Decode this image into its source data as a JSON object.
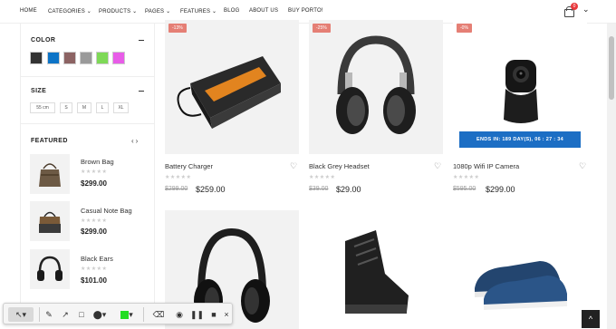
{
  "nav": {
    "items": [
      "HOME",
      "CATEGORIES",
      "PRODUCTS",
      "PAGES",
      "FEATURES",
      "BLOG",
      "ABOUT US",
      "BUY PORTO!"
    ],
    "cart_count": "0"
  },
  "sidebar": {
    "color_title": "COLOR",
    "colors": [
      "#333333",
      "#0d74c7",
      "#8c6363",
      "#9a9a9a",
      "#7ed957",
      "#e85ce8"
    ],
    "size_title": "SIZE",
    "sizes": [
      "55 cm",
      "S",
      "M",
      "L",
      "XL"
    ],
    "featured_title": "FEATURED",
    "featured": [
      {
        "name": "Brown Bag",
        "stars": "★★★★★",
        "price": "$299.00"
      },
      {
        "name": "Casual Note Bag",
        "stars": "★★★★★",
        "price": "$299.00"
      },
      {
        "name": "Black Ears",
        "stars": "★★★★★",
        "price": "$101.00"
      }
    ]
  },
  "products": [
    {
      "badge": "-13%",
      "name": "Battery Charger",
      "stars": "★★★★★",
      "old_price": "$299.00",
      "price": "$259.00",
      "icon": "power-bank"
    },
    {
      "badge": "-25%",
      "name": "Black Grey Headset",
      "stars": "★★★★★",
      "old_price": "$39.00",
      "price": "$29.00",
      "icon": "headset"
    },
    {
      "badge": "-0%",
      "name": "1080p Wifi IP Camera",
      "stars": "★★★★★",
      "old_price": "$595.00",
      "price": "$299.00",
      "icon": "ip-camera",
      "countdown": "ENDS IN: 189 DAY(S), 06 : 27 : 34"
    },
    {
      "name": "",
      "icon": "headphones"
    },
    {
      "name": "",
      "icon": "boots"
    },
    {
      "name": "",
      "icon": "dress-shoes"
    }
  ],
  "toolbar": {
    "tools": [
      "cursor-select",
      "pen",
      "arrow",
      "rectangle",
      "marker",
      "color-picker",
      "eraser",
      "screenshot",
      "pause",
      "stop",
      "close"
    ],
    "active_color": "#22dd22"
  },
  "scroll_top": "^"
}
